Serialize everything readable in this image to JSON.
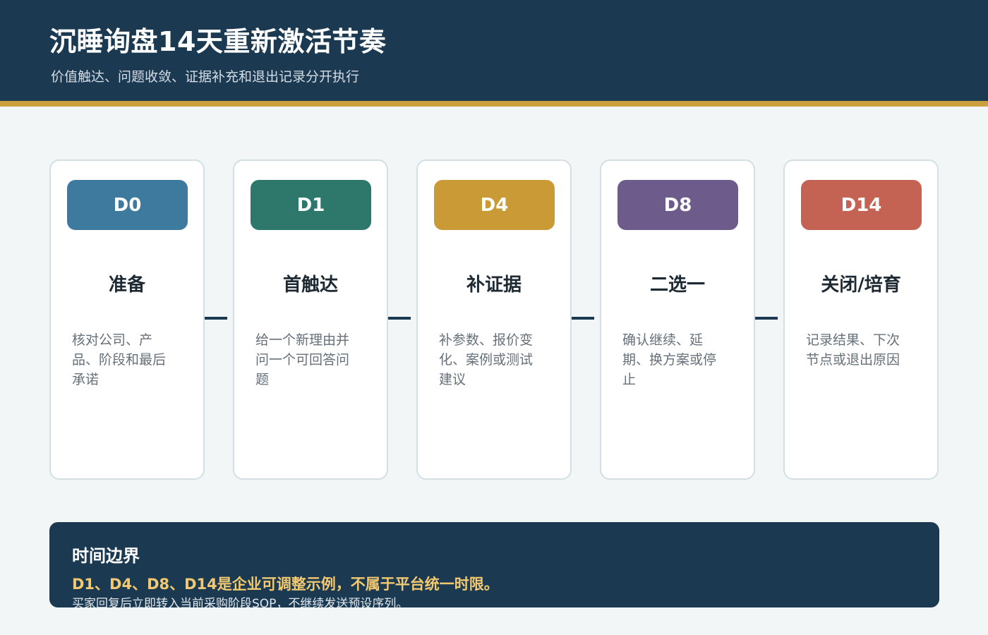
{
  "header": {
    "title": "沉睡询盘14天重新激活节奏",
    "subtitle": "价值触达、问题收敛、证据补充和退出记录分开执行"
  },
  "steps": [
    {
      "day": "D0",
      "title": "准备",
      "description": "核对公司、产品、阶段和最后承诺",
      "color": "#3d7a9e"
    },
    {
      "day": "D1",
      "title": "首触达",
      "description": "给一个新理由并问一个可回答问题",
      "color": "#2e776b"
    },
    {
      "day": "D4",
      "title": "补证据",
      "description": "补参数、报价变化、案例或测试建议",
      "color": "#c99a35"
    },
    {
      "day": "D8",
      "title": "二选一",
      "description": "确认继续、延期、换方案或停止",
      "color": "#6d5b8c"
    },
    {
      "day": "D14",
      "title": "关闭/培育",
      "description": "记录结果、下次节点或退出原因",
      "color": "#c46253"
    }
  ],
  "note": {
    "title": "时间边界",
    "highlight": "D1、D4、D8、D14是企业可调整示例，不属于平台统一时限。",
    "text": "买家回复后立即转入当前采购阶段SOP，不继续发送预设序列。"
  },
  "colors": {
    "header_bg": "#1b3a52",
    "accent_rule": "#c9a03d",
    "highlight_text": "#f2c970"
  }
}
